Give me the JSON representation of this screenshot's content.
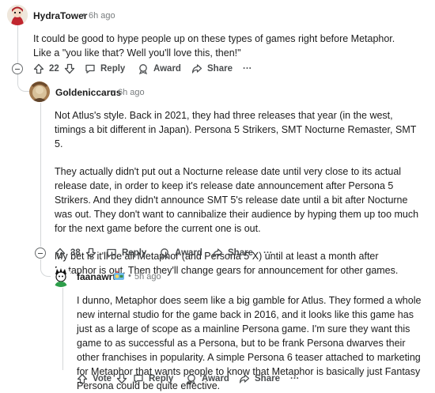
{
  "comments": [
    {
      "username": "HydraTower",
      "time": "6h ago",
      "paragraphs": [
        "It could be good to hype people up on these types of games right before Metaphor. Like a \"you like that? Well you'll love this, then!\""
      ],
      "actions": {
        "votes": "22",
        "reply": "Reply",
        "award": "Award",
        "share": "Share",
        "more": "···"
      }
    },
    {
      "username": "Goldeniccarus",
      "time": "6h ago",
      "paragraphs": [
        "Not Atlus's style. Back in 2021, they had three releases that year (in the west, timings a bit different in Japan). Persona 5 Strikers, SMT Nocturne Remaster, SMT 5.",
        "They actually didn't put out a Nocturne release date until very close to its actual release date, in order to keep it's release date announcement after Persona 5 Strikers. And they didn't announce SMT 5's release date until a bit after Nocturne was out. They don't want to cannibalize their audience by hyping them up too much for the next game before the current one is out.",
        "My bet is it'll be all Metaphor (and Persona 5 X) until at least a month after Metaphor is out. Then they'll change gears for announcement for other games."
      ],
      "actions": {
        "votes": "38",
        "reply": "Reply",
        "award": "Award",
        "share": "Share",
        "more": "···"
      }
    },
    {
      "username": "faanawrt",
      "time": "5h ago",
      "flair_icon": "flair-emoji-icon",
      "paragraphs": [
        "I dunno, Metaphor does seem like a big gamble for Atlus. They formed a whole new internal studio for the game back in 2016, and it looks like this game has just as a large of scope as a mainline Persona game. I'm sure they want this game to as successful as a Persona, but to be frank Persona dwarves their other franchises in popularity. A simple Persona 6 teaser attached to marketing for Metaphor that wants people to know that Metaphor is basically just Fantasy Persona could be quite effective."
      ],
      "actions": {
        "votes": "Vote",
        "reply": "Reply",
        "award": "Award",
        "share": "Share",
        "more": "···"
      }
    }
  ],
  "colors": {
    "text": "#1c1c1c",
    "meta": "#787c7e",
    "action": "#4a4d4f",
    "thread": "#d4d7d9"
  }
}
